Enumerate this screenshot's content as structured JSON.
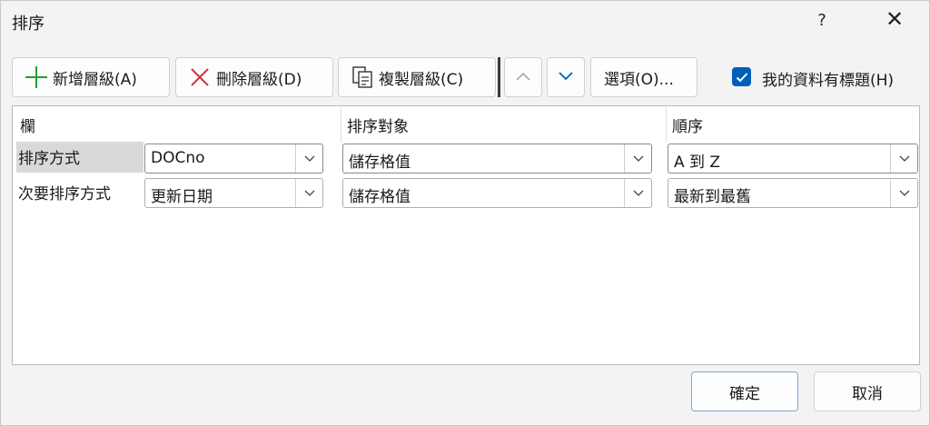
{
  "window": {
    "title": "排序",
    "help": "?",
    "close": "✕"
  },
  "toolbar": {
    "add_label": "新增層級(A)",
    "delete_label": "刪除層級(D)",
    "copy_label": "複製層級(C)",
    "options_label": "選項(O)...",
    "has_headers_label": "我的資料有標題(H)",
    "has_headers_checked": true
  },
  "grid": {
    "columns": [
      "欄",
      "排序對象",
      "順序"
    ],
    "rows": [
      {
        "label": "排序方式",
        "column": "DOCno",
        "sort_on": "儲存格值",
        "order": "A 到 Z",
        "selected": true
      },
      {
        "label": "次要排序方式",
        "column": "更新日期",
        "sort_on": "儲存格值",
        "order": "最新到最舊",
        "selected": false
      }
    ]
  },
  "footer": {
    "ok_label": "確定",
    "cancel_label": "取消"
  },
  "colors": {
    "accent": "#005fb8",
    "add_icon": "#1e9e3a",
    "delete_icon": "#d13438"
  }
}
